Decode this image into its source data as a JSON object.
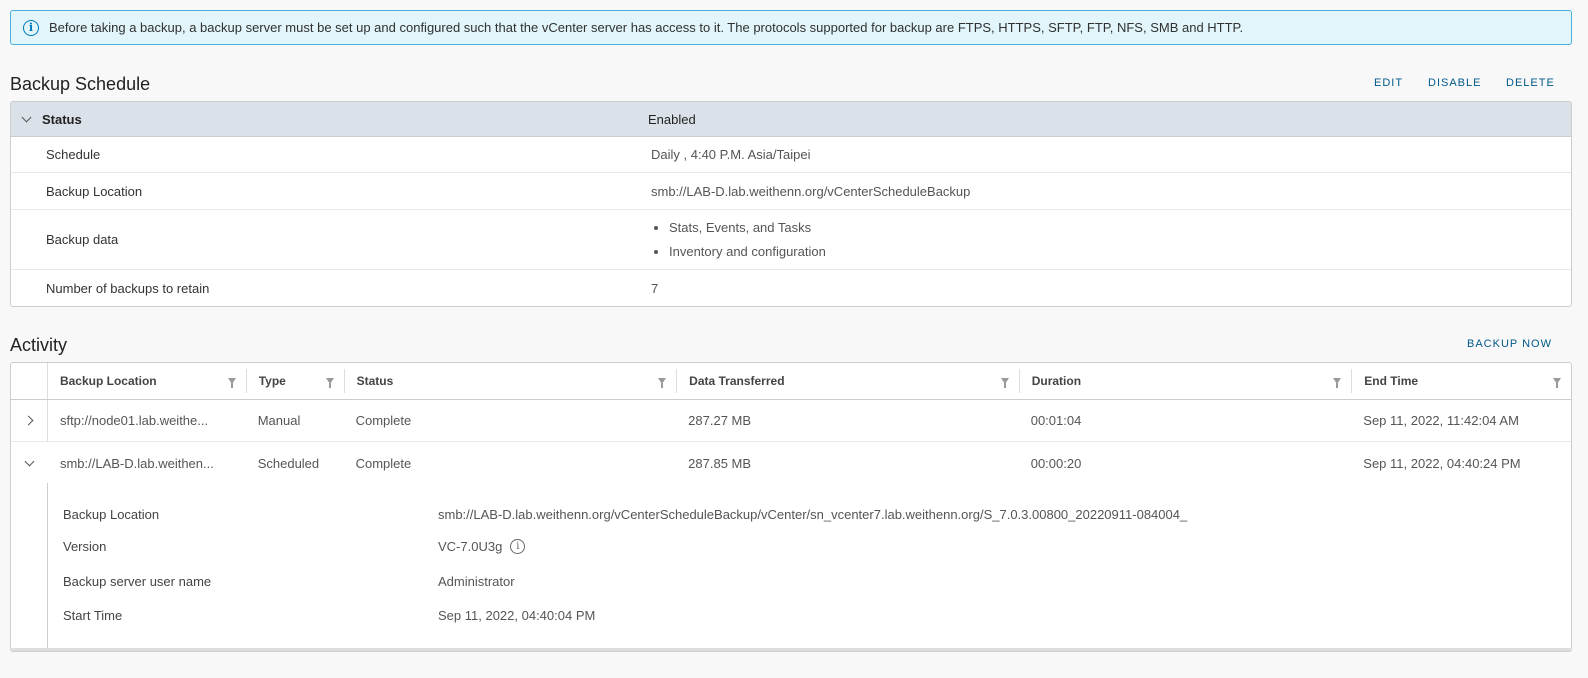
{
  "alert": {
    "icon": "info-icon",
    "text": "Before taking a backup, a backup server must be set up and configured such that the vCenter server has access to it. The protocols supported for backup are FTPS, HTTPS, SFTP, FTP, NFS, SMB and HTTP."
  },
  "schedule": {
    "title": "Backup Schedule",
    "actions": {
      "edit": "EDIT",
      "disable": "DISABLE",
      "delete": "DELETE"
    },
    "status_label": "Status",
    "status_value": "Enabled",
    "rows": {
      "schedule": {
        "label": "Schedule",
        "value": "Daily , 4:40 P.M. Asia/Taipei"
      },
      "location": {
        "label": "Backup Location",
        "value": "smb://LAB-D.lab.weithenn.org/vCenterScheduleBackup"
      },
      "data": {
        "label": "Backup data",
        "items": [
          "Stats, Events, and Tasks",
          "Inventory and configuration"
        ]
      },
      "retain": {
        "label": "Number of backups to retain",
        "value": "7"
      }
    }
  },
  "activity": {
    "title": "Activity",
    "backup_now": "BACKUP NOW",
    "columns": {
      "location": "Backup Location",
      "type": "Type",
      "status": "Status",
      "data": "Data Transferred",
      "duration": "Duration",
      "end": "End Time"
    },
    "rows": [
      {
        "location": "sftp://node01.lab.weithe...",
        "type": "Manual",
        "status": "Complete",
        "data": "287.27 MB",
        "duration": "00:01:04",
        "end": "Sep 11, 2022, 11:42:04 AM"
      },
      {
        "location": "smb://LAB-D.lab.weithen...",
        "type": "Scheduled",
        "status": "Complete",
        "data": "287.85 MB",
        "duration": "00:00:20",
        "end": "Sep 11, 2022, 04:40:24 PM"
      }
    ],
    "detail": {
      "location_label": "Backup Location",
      "location_value": "smb://LAB-D.lab.weithenn.org/vCenterScheduleBackup/vCenter/sn_vcenter7.lab.weithenn.org/S_7.0.3.00800_20220911-084004_",
      "version_label": "Version",
      "version_value": "VC-7.0U3g",
      "user_label": "Backup server user name",
      "user_value": "Administrator",
      "start_label": "Start Time",
      "start_value": "Sep 11, 2022, 04:40:04 PM"
    }
  },
  "colors": {
    "accent": "#00598a",
    "alert_bg": "#e1f5fa",
    "alert_border": "#49afd9",
    "header_bg": "#dae1e8"
  }
}
